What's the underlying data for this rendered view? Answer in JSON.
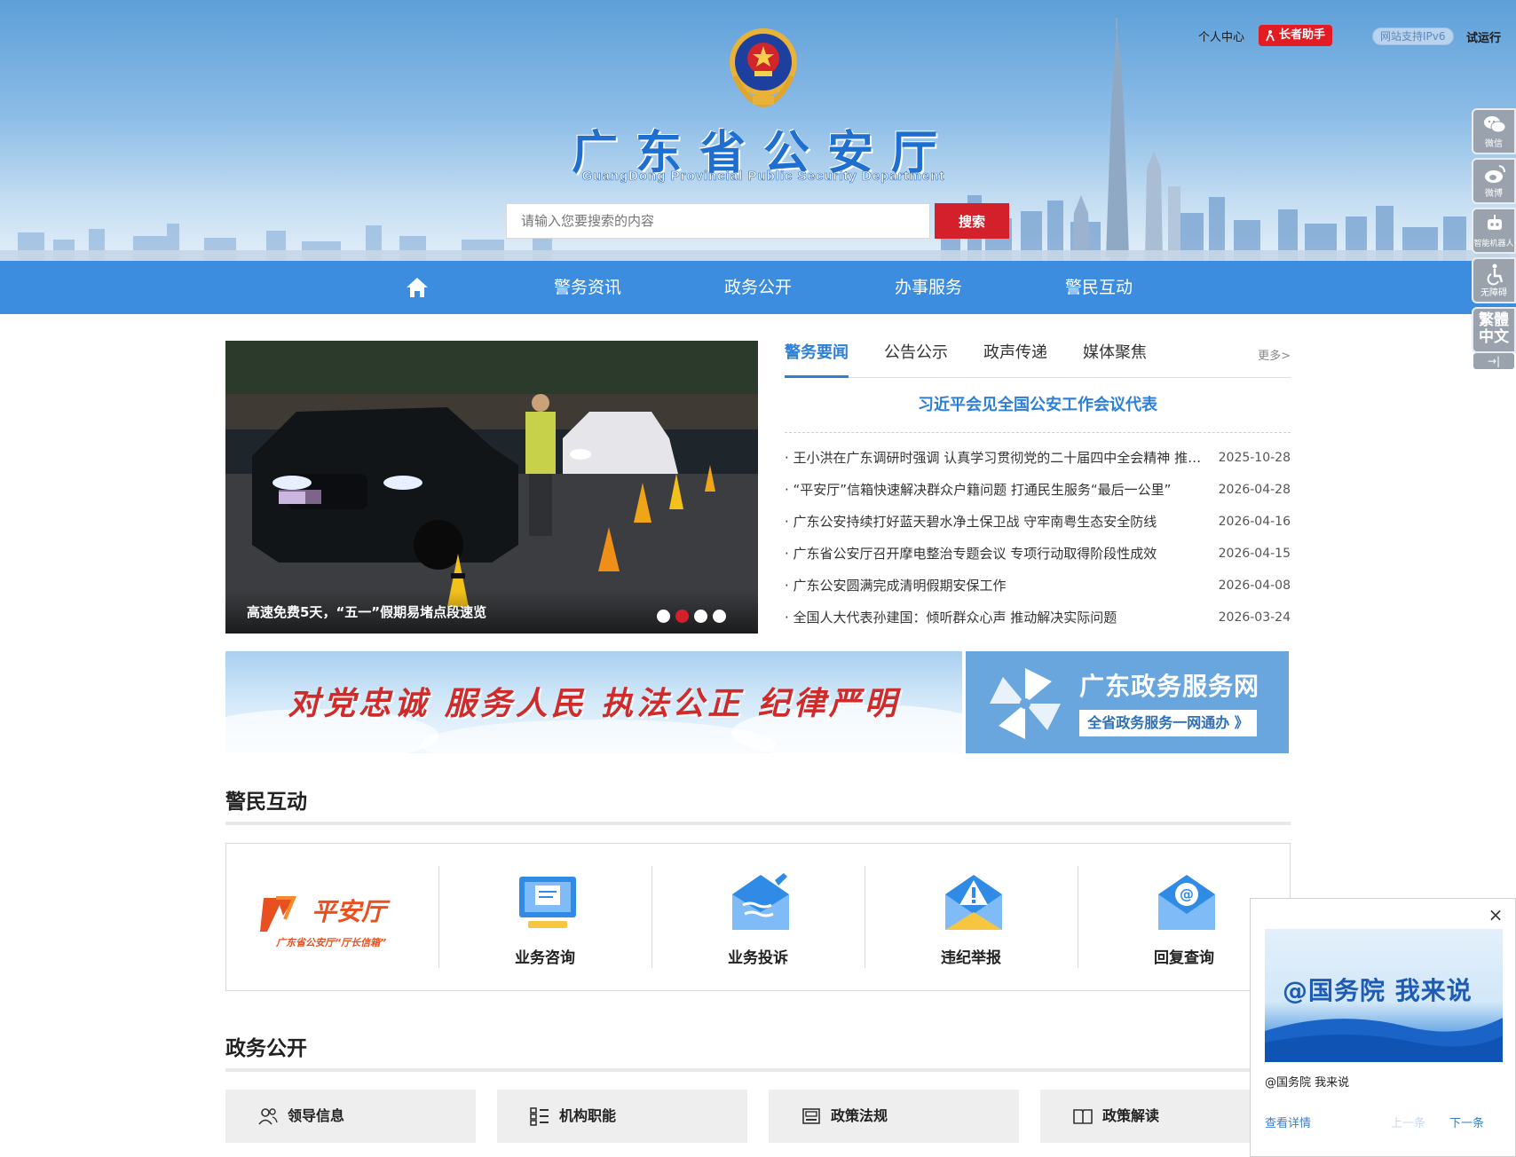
{
  "header": {
    "title": "广东省公安厅",
    "subtitle": "GuangDong Provincial Public Security Department",
    "search_placeholder": "请输入您要搜索的内容",
    "search_button": "搜索",
    "personal_center": "个人中心",
    "elder_helper": "长者助手",
    "ipv6": "网站支持IPv6",
    "trial": "试运行"
  },
  "nav": {
    "home_icon": "home-icon",
    "items": [
      {
        "label": "警务资讯"
      },
      {
        "label": "政务公开"
      },
      {
        "label": "办事服务"
      },
      {
        "label": "警民互动"
      }
    ]
  },
  "carousel": {
    "caption": "高速免费5天，“五一”假期易堵点段速览",
    "dots": 4,
    "active_dot": 2
  },
  "news": {
    "tabs": [
      {
        "label": "警务要闻"
      },
      {
        "label": "公告公示"
      },
      {
        "label": "政声传递"
      },
      {
        "label": "媒体聚焦"
      }
    ],
    "more": "更多>",
    "headline": "习近平会见全国公安工作会议代表",
    "items": [
      {
        "title": "· 王小洪在广东调研时强调 认真学习贯彻党的二十届四中全会精神 推动公安工作高质量发展",
        "date": "2025-10-28"
      },
      {
        "title": "· “平安厅”信箱快速解决群众户籍问题 打通民生服务“最后一公里”",
        "date": "2026-04-28"
      },
      {
        "title": "· 广东公安持续打好蓝天碧水净土保卫战 守牢南粤生态安全防线",
        "date": "2026-04-16"
      },
      {
        "title": "· 广东省公安厅召开摩电整治专题会议 专项行动取得阶段性成效",
        "date": "2026-04-15"
      },
      {
        "title": "· 广东公安圆满完成清明假期安保工作",
        "date": "2026-04-08"
      },
      {
        "title": "· 全国人大代表孙建国：倾听群众心声 推动解决实际问题",
        "date": "2026-03-24"
      }
    ]
  },
  "banners": {
    "slogan": "对党忠诚  服务人民  执法公正  纪律严明",
    "gov_service_title": "广东政务服务网",
    "gov_service_button": "全省政务服务一网通办 》"
  },
  "interaction": {
    "title": "警民互动",
    "logo_main": "平安厅",
    "logo_sub": "广东省公安厅“厅长信箱”",
    "items": [
      {
        "label": "业务咨询",
        "icon": "consult-monitor-icon"
      },
      {
        "label": "业务投诉",
        "icon": "complaint-envelope-icon"
      },
      {
        "label": "违纪举报",
        "icon": "report-warning-icon"
      },
      {
        "label": "回复查询",
        "icon": "reply-at-icon"
      }
    ]
  },
  "gov_open": {
    "title": "政务公开",
    "items": [
      {
        "label": "领导信息",
        "icon": "people-icon"
      },
      {
        "label": "机构职能",
        "icon": "org-icon"
      },
      {
        "label": "政策法规",
        "icon": "document-icon"
      },
      {
        "label": "政策解读",
        "icon": "book-icon"
      }
    ]
  },
  "float_bar": {
    "items": [
      {
        "label": "微信",
        "icon": "wechat-icon"
      },
      {
        "label": "微博",
        "icon": "weibo-icon"
      },
      {
        "label": "智能机器人",
        "icon": "robot-icon"
      },
      {
        "label": "无障碍",
        "icon": "accessibility-icon"
      }
    ],
    "traditional": "繁體中文",
    "collapse": "→|"
  },
  "popup": {
    "image_text": "@国务院  我来说",
    "caption": "@国务院 我来说",
    "detail": "查看详情",
    "prev": "上一条",
    "next": "下一条",
    "close": "×"
  },
  "colors": {
    "brand_blue": "#3c8de0",
    "accent_red": "#d4202a",
    "link_blue": "#2e7fd6"
  }
}
